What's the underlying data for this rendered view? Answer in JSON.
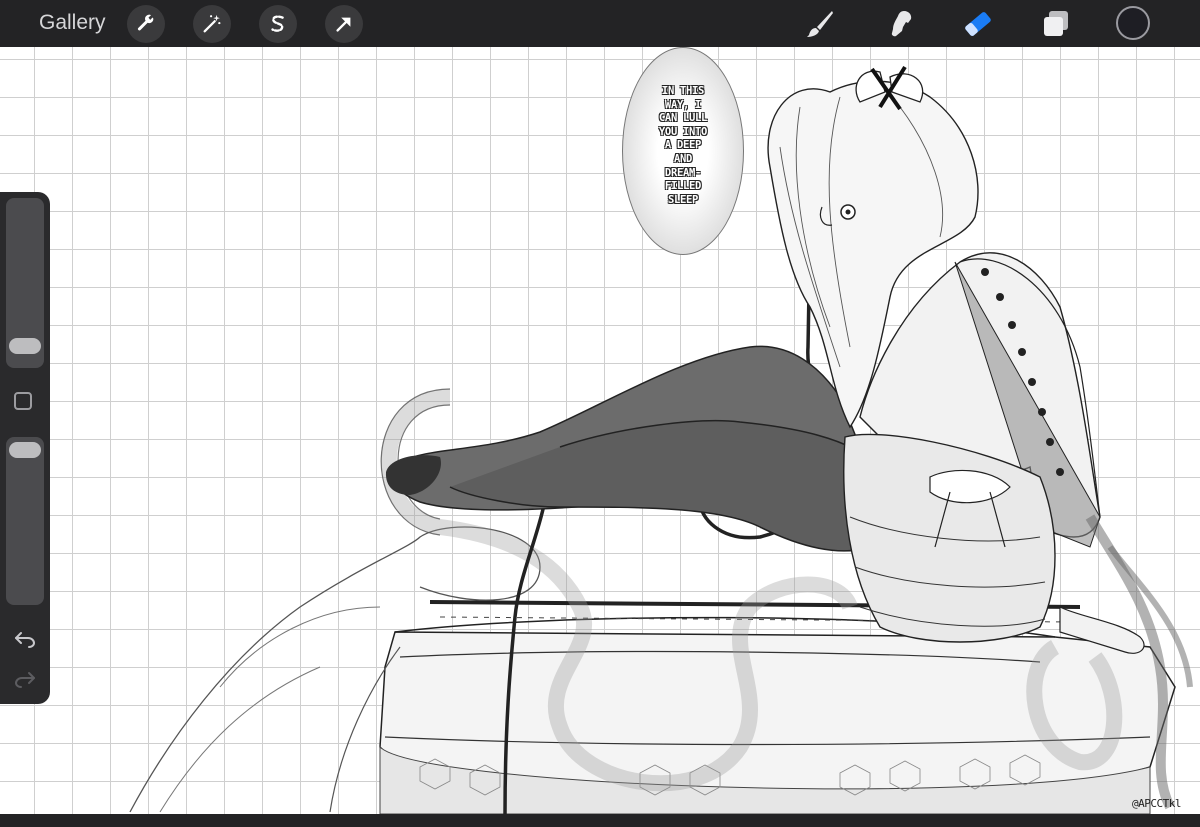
{
  "topbar": {
    "gallery_label": "Gallery",
    "left_tools": [
      "wrench-icon",
      "magic-wand-icon",
      "selection-s-icon",
      "transform-arrow-icon"
    ],
    "right_tools": [
      "brush-icon",
      "smudge-icon",
      "eraser-icon",
      "layers-icon"
    ],
    "active_tool": "eraser",
    "accent_color": "#1a7cf5",
    "current_color": "#1e1e24"
  },
  "sidebar": {
    "brush_size_level": 0.08,
    "opacity_level": 0.92,
    "undo_icon": "undo-icon",
    "redo_icon": "redo-icon"
  },
  "canvas": {
    "speech_bubble_text": "IN THIS WAY, I CAN LULL YOU INTO A DEEP AND DREAM-FILLED SLEEP",
    "speech_bubble_lines": [
      "IN THIS",
      "WAY, I",
      "CAN LULL",
      "YOU INTO",
      "A DEEP",
      "AND",
      "DREAM-",
      "FILLED",
      "SLEEP"
    ],
    "signature": "@APCCTkl",
    "grid": true
  }
}
